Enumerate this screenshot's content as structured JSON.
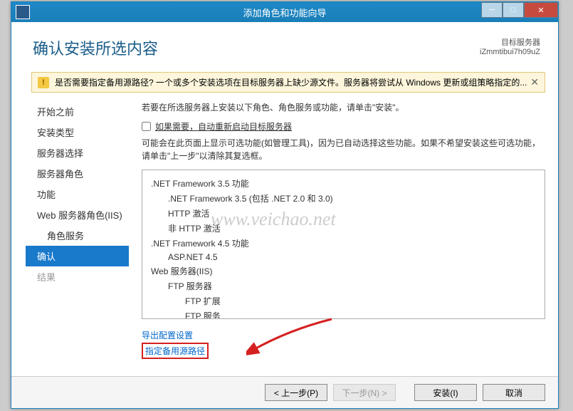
{
  "titlebar": {
    "title": "添加角色和功能向导"
  },
  "header": {
    "page_title": "确认安装所选内容",
    "target_label": "目标服务器",
    "target_name": "iZmmtibui7h09uZ"
  },
  "warning": {
    "text": "是否需要指定备用源路径? 一个或多个安装选项在目标服务器上缺少源文件。服务器将尝试从 Windows 更新或组策略指定的..."
  },
  "sidebar": {
    "items": [
      {
        "label": "开始之前",
        "indent": false,
        "selected": false
      },
      {
        "label": "安装类型",
        "indent": false,
        "selected": false
      },
      {
        "label": "服务器选择",
        "indent": false,
        "selected": false
      },
      {
        "label": "服务器角色",
        "indent": false,
        "selected": false
      },
      {
        "label": "功能",
        "indent": false,
        "selected": false
      },
      {
        "label": "Web 服务器角色(IIS)",
        "indent": false,
        "selected": false
      },
      {
        "label": "角色服务",
        "indent": true,
        "selected": false
      },
      {
        "label": "确认",
        "indent": false,
        "selected": true
      },
      {
        "label": "结果",
        "indent": false,
        "selected": false,
        "disabled": true
      }
    ]
  },
  "content": {
    "intro": "若要在所选服务器上安装以下角色、角色服务或功能，请单击\"安装\"。",
    "checkbox_label": "如果需要，自动重新启动目标服务器",
    "note": "可能会在此页面上显示可选功能(如管理工具)，因为已自动选择这些功能。如果不希望安装这些可选功能，请单击\"上一步\"以清除其复选框。",
    "features": [
      {
        "text": ".NET Framework 3.5 功能",
        "indent": 0
      },
      {
        "text": ".NET Framework 3.5 (包括 .NET 2.0 和 3.0)",
        "indent": 1
      },
      {
        "text": "HTTP 激活",
        "indent": 1
      },
      {
        "text": "非 HTTP 激活",
        "indent": 1
      },
      {
        "text": ".NET Framework 4.5 功能",
        "indent": 0
      },
      {
        "text": "ASP.NET 4.5",
        "indent": 1
      },
      {
        "text": "Web 服务器(IIS)",
        "indent": 0
      },
      {
        "text": "FTP 服务器",
        "indent": 1
      },
      {
        "text": "FTP 扩展",
        "indent": 2
      },
      {
        "text": "FTP 服务",
        "indent": 2
      }
    ],
    "link_export": "导出配置设置",
    "link_source": "指定备用源路径"
  },
  "footer": {
    "prev": "< 上一步(P)",
    "next": "下一步(N) >",
    "install": "安装(I)",
    "cancel": "取消"
  },
  "watermark": "www.veichao.net"
}
